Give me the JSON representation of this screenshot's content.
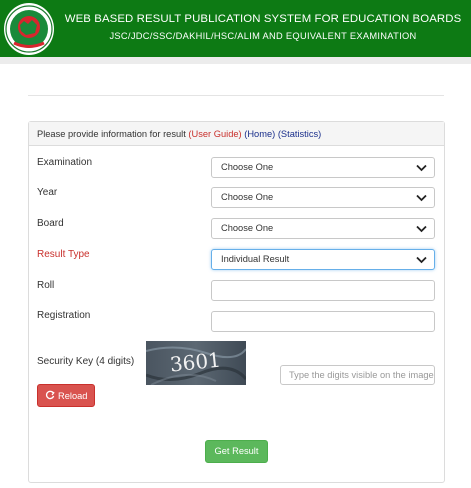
{
  "header": {
    "title": "WEB BASED RESULT PUBLICATION SYSTEM FOR EDUCATION BOARDS",
    "subtitle": "JSC/JDC/SSC/DAKHIL/HSC/ALIM AND EQUIVALENT EXAMINATION",
    "logo_icon": "bangladesh-govt-emblem",
    "bar_color": "#0d7a14"
  },
  "panel": {
    "intro": "Please provide information for result",
    "user_guide": "(User Guide)",
    "home": "(Home)",
    "statistics": "(Statistics)"
  },
  "form": {
    "examination": {
      "label": "Examination",
      "value": "Choose One"
    },
    "year": {
      "label": "Year",
      "value": "Choose One"
    },
    "board": {
      "label": "Board",
      "value": "Choose One"
    },
    "result_type": {
      "label": "Result Type",
      "value": "Individual Result"
    },
    "roll": {
      "label": "Roll",
      "value": ""
    },
    "registration": {
      "label": "Registration",
      "value": ""
    },
    "security_key": {
      "label": "Security Key (4 digits)",
      "placeholder": "Type the digits visible on the image",
      "captcha_digits": "3601"
    }
  },
  "buttons": {
    "reload": "Reload",
    "reload_icon": "refresh-icon",
    "get_result": "Get Result"
  },
  "colors": {
    "danger": "#d9534f",
    "success": "#5cb85c",
    "link_red": "#c9302c",
    "link_blue": "#1a2f8c"
  }
}
